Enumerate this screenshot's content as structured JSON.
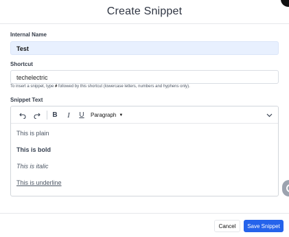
{
  "dialog": {
    "title": "Create Snippet"
  },
  "fields": {
    "name_label": "Internal Name",
    "name_value": "Test",
    "shortcut_label": "Shortcut",
    "shortcut_value": "techelectric",
    "help_prefix": "To insert a snippet, type ",
    "help_key": "#",
    "help_suffix": " followed by this shortcut (lowercase letters, numbers and hyphens only).",
    "text_label": "Snippet Text"
  },
  "toolbar": {
    "undo_icon": "undo-icon",
    "redo_icon": "redo-icon",
    "bold_glyph": "B",
    "italic_glyph": "I",
    "underline_glyph": "U",
    "paragraph_label": "Paragraph",
    "paragraph_caret": "▼",
    "expand_icon": "chevron-down-icon"
  },
  "editor": {
    "lines": [
      "This is plain",
      "This is bold",
      "This is italic",
      "This is underline"
    ]
  },
  "footer": {
    "cancel_label": "Cancel",
    "save_label": "Save Snippet"
  },
  "colors": {
    "primary": "#2563eb",
    "name_input_bg": "#e8f0fe"
  }
}
